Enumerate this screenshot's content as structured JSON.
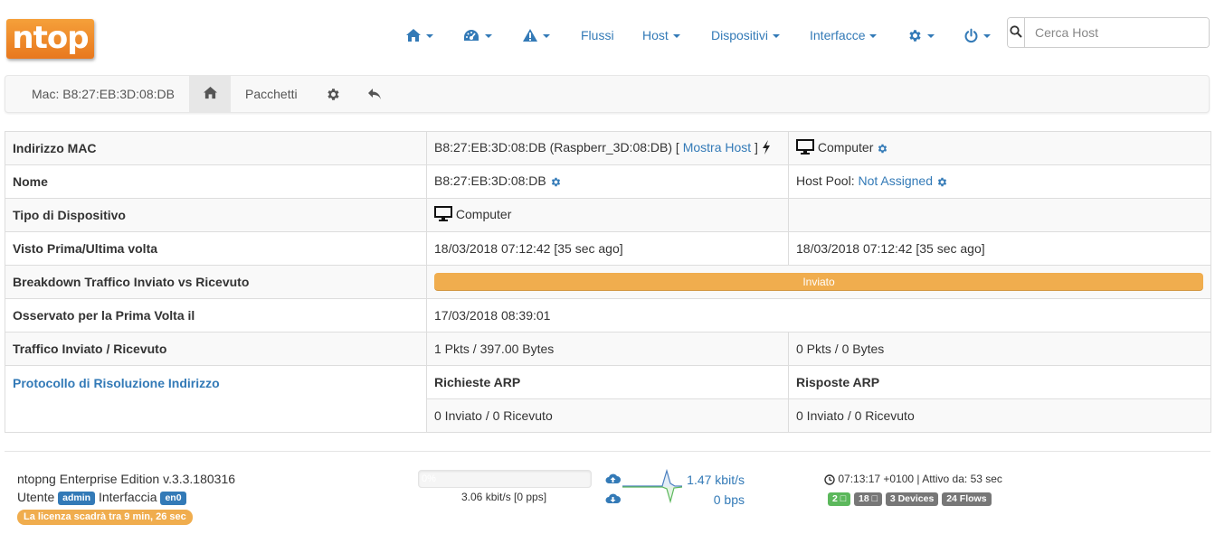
{
  "brand": {
    "logo": "ntop"
  },
  "nav": {
    "items": [
      {
        "icon": "home-icon",
        "caret": true
      },
      {
        "icon": "dashboard-icon",
        "caret": true
      },
      {
        "icon": "alert-icon",
        "caret": true
      },
      {
        "label": "Flussi",
        "caret": false
      },
      {
        "label": "Host",
        "caret": true
      },
      {
        "label": "Dispositivi",
        "caret": true
      },
      {
        "label": "Interfacce",
        "caret": true
      },
      {
        "icon": "gear-icon",
        "caret": true
      },
      {
        "icon": "power-icon",
        "caret": true
      }
    ],
    "search_placeholder": "Cerca Host"
  },
  "subnav": {
    "brand": "Mac: B8:27:EB:3D:08:DB",
    "packets": "Pacchetti"
  },
  "info": {
    "mac": {
      "label": "Indirizzo MAC",
      "value": "B8:27:EB:3D:08:DB (Raspberr_3D:08:DB) [ ",
      "link": "Mostra Host",
      "value_end": " ]",
      "device": "Computer"
    },
    "name": {
      "label": "Nome",
      "value": "B8:27:EB:3D:08:DB",
      "pool_label": "Host Pool: ",
      "pool_value": "Not Assigned"
    },
    "device_type": {
      "label": "Tipo di Dispositivo",
      "value": "Computer"
    },
    "seen": {
      "label": "Visto Prima/Ultima volta",
      "first": "18/03/2018 07:12:42 [35 sec ago]",
      "last": "18/03/2018 07:12:42 [35 sec ago]"
    },
    "breakdown": {
      "label": "Breakdown Traffico Inviato vs Ricevuto",
      "bar_label": "Inviato",
      "sent_percent": 100
    },
    "first_observed": {
      "label": "Osservato per la Prima Volta il",
      "value": "17/03/2018 08:39:01"
    },
    "traffic": {
      "label": "Traffico Inviato / Ricevuto",
      "sent": "1 Pkts / 397.00 Bytes",
      "received": "0 Pkts / 0 Bytes"
    },
    "arp": {
      "label": "Protocollo di Risoluzione Indirizzo",
      "requests_header": "Richieste ARP",
      "replies_header": "Risposte ARP",
      "requests": "0 Inviato / 0 Ricevuto",
      "replies": "0 Inviato / 0 Ricevuto"
    }
  },
  "footer": {
    "edition": "ntopng Enterprise Edition v.3.3.180316",
    "user_label": "Utente",
    "user_badge": "admin",
    "iface_label": "Interfaccia",
    "iface_badge": "en0",
    "license": "La licenza scadrà tra 9 min, 26 sec",
    "throughput_pct": "0%",
    "throughput_text": "3.06 kbit/s [0 pps]",
    "upload_rate": "1.47 kbit/s",
    "download_rate": "0 bps",
    "clock": "07:13:17 +0100 | Attivo da: 53 sec",
    "badges": {
      "local_hosts": "2",
      "remote_hosts": "18",
      "devices": "3 Devices",
      "flows": "24 Flows"
    }
  },
  "colors": {
    "link": "#337ab7",
    "warning": "#f0ad4e",
    "success": "#5cb85c",
    "muted": "#777777"
  }
}
